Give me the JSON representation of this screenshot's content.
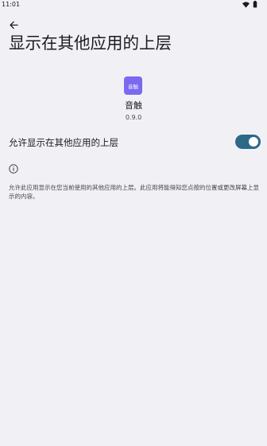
{
  "status_bar": {
    "time": "11:01",
    "icons": [
      "wifi-icon",
      "battery-icon"
    ]
  },
  "header": {
    "back_icon": "arrow-left-icon",
    "title": "显示在其他应用的上层"
  },
  "app": {
    "icon_text": "音触",
    "icon_color": "#7b69f0",
    "name": "音触",
    "version": "0.9.0"
  },
  "setting": {
    "label": "允许显示在其他应用的上层",
    "enabled": true,
    "toggle_color": "#2d6a87"
  },
  "info": {
    "icon": "info-icon",
    "text": "允许此应用显示在您当前使用的其他应用的上层。此应用将能得知您点按的位置或更改屏幕上显示的内容。"
  }
}
